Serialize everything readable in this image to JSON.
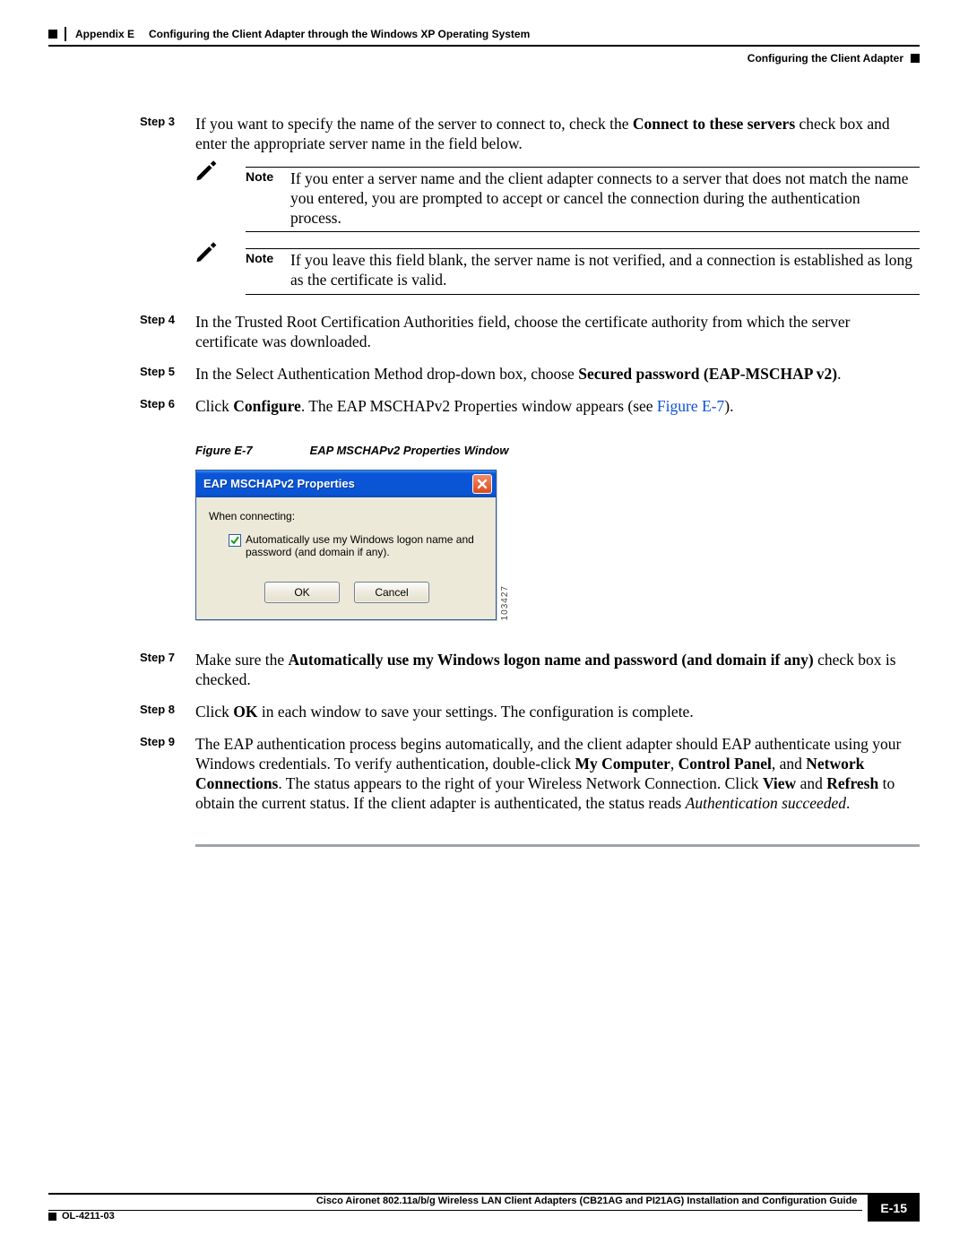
{
  "header": {
    "appendix": "Appendix E",
    "title": "Configuring the Client Adapter through the Windows XP Operating System",
    "sub": "Configuring the Client Adapter"
  },
  "steps": {
    "s3": {
      "label": "Step 3",
      "t1": "If you want to specify the name of the server to connect to, check the ",
      "b1": "Connect to these servers",
      "t2": " check box and enter the appropriate server name in the field below."
    },
    "n1": {
      "label": "Note",
      "text": "If you enter a server name and the client adapter connects to a server that does not match the name you entered, you are prompted to accept or cancel the connection during the authentication process."
    },
    "n2": {
      "label": "Note",
      "text": "If you leave this field blank, the server name is not verified, and a connection is established as long as the certificate is valid."
    },
    "s4": {
      "label": "Step 4",
      "t1": "In the Trusted Root Certification Authorities field, choose the certificate authority from which the server certificate was downloaded."
    },
    "s5": {
      "label": "Step 5",
      "t1": "In the Select Authentication Method drop-down box, choose ",
      "b1": "Secured password (EAP-MSCHAP v2)",
      "t2": "."
    },
    "s6": {
      "label": "Step 6",
      "t1": "Click ",
      "b1": "Configure",
      "t2": ". The EAP MSCHAPv2 Properties window appears (see ",
      "link": "Figure E-7",
      "t3": ")."
    },
    "s7": {
      "label": "Step 7",
      "t1": "Make sure the ",
      "b1": "Automatically use my Windows logon name and password (and domain if any)",
      "t2": " check box is checked."
    },
    "s8": {
      "label": "Step 8",
      "t1": "Click ",
      "b1": "OK",
      "t2": " in each window to save your settings. The configuration is complete."
    },
    "s9": {
      "label": "Step 9",
      "t1": "The EAP authentication process begins automatically, and the client adapter should EAP authenticate using your Windows credentials. To verify authentication, double-click ",
      "b1": "My Computer",
      "t2": ", ",
      "b2": "Control Panel",
      "t3": ", and ",
      "b3": "Network Connections",
      "t4": ". The status appears to the right of your Wireless Network Connection. Click ",
      "b4": "View",
      "t5": " and ",
      "b5": "Refresh",
      "t6": " to obtain the current status. If the client adapter is authenticated, the status reads ",
      "i1": "Authentication succeeded",
      "t7": "."
    }
  },
  "figure": {
    "num": "Figure E-7",
    "title": "EAP MSCHAPv2 Properties Window",
    "sidecode": "103427"
  },
  "dialog": {
    "title": "EAP MSCHAPv2 Properties",
    "when": "When connecting:",
    "check": "Automatically use my Windows logon name and password (and domain if any).",
    "ok": "OK",
    "cancel": "Cancel"
  },
  "footer": {
    "guide": "Cisco Aironet 802.11a/b/g Wireless LAN Client Adapters (CB21AG and PI21AG) Installation and Configuration Guide",
    "doc": "OL-4211-03",
    "page": "E-15"
  }
}
